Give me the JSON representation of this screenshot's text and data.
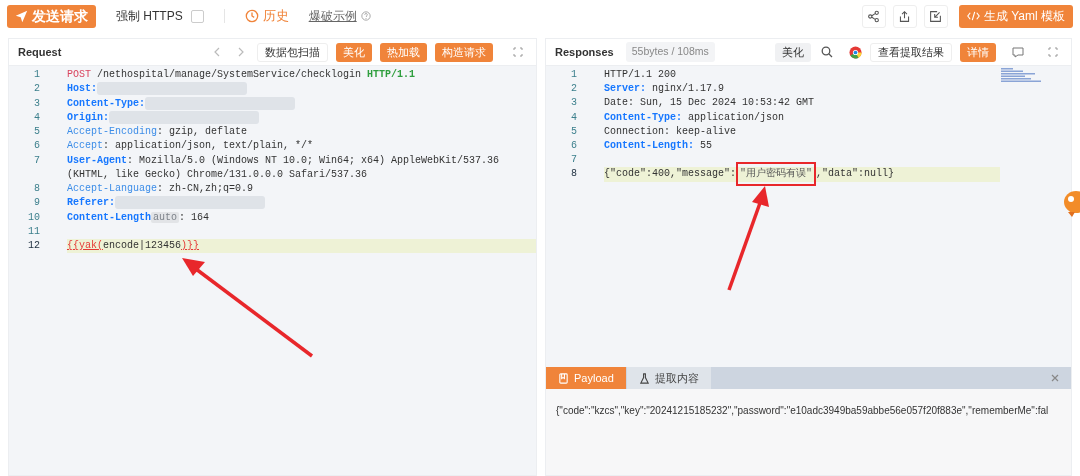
{
  "toolbar": {
    "send_button": "发送请求",
    "force_https": {
      "label": "强制 HTTPS",
      "checked": false
    },
    "history": "历史",
    "example_link": "爆破示例",
    "yaml_button": "生成 Yaml 模板"
  },
  "request": {
    "title": "Request",
    "buttons": [
      {
        "label": "数据包扫描",
        "kind": "default"
      },
      {
        "label": "美化",
        "kind": "primary"
      },
      {
        "label": "热加载",
        "kind": "primary"
      },
      {
        "label": "构造请求",
        "kind": "primary"
      }
    ],
    "lines": [
      {
        "number": "1",
        "highlighted": false,
        "segments": [
          {
            "kind": "method",
            "text": "POST"
          },
          {
            "kind": "plain",
            "text": " /nethospital/manage/SystemService/checklogin "
          },
          {
            "kind": "version",
            "text": "HTTP/1.1"
          }
        ]
      },
      {
        "number": "2",
        "highlighted": false,
        "segments": [
          {
            "kind": "key",
            "text": "Host:"
          },
          {
            "kind": "redacted"
          }
        ]
      },
      {
        "number": "3",
        "highlighted": false,
        "segments": [
          {
            "kind": "key",
            "text": "Content-Type:"
          },
          {
            "kind": "redacted"
          }
        ]
      },
      {
        "number": "4",
        "highlighted": false,
        "segments": [
          {
            "kind": "key",
            "text": "Origin:"
          },
          {
            "kind": "redacted"
          }
        ]
      },
      {
        "number": "5",
        "highlighted": false,
        "segments": [
          {
            "kind": "key_light",
            "text": "Accept-Encoding"
          },
          {
            "kind": "plain",
            "text": ": gzip, deflate"
          }
        ]
      },
      {
        "number": "6",
        "highlighted": false,
        "segments": [
          {
            "kind": "key_light",
            "text": "Accept"
          },
          {
            "kind": "plain",
            "text": ": application/json, text/plain, */*"
          }
        ]
      },
      {
        "number": "7",
        "highlighted": false,
        "segments": [
          {
            "kind": "key",
            "text": "User-Agent"
          },
          {
            "kind": "plain",
            "text": ": Mozilla/5.0 (Windows NT 10.0; Win64; x64) AppleWebKit/537.36 (KHTML, like Gecko) Chrome/131.0.0.0 Safari/537.36"
          }
        ]
      },
      {
        "number": "8",
        "highlighted": false,
        "segments": [
          {
            "kind": "key_light",
            "text": "Accept-Language"
          },
          {
            "kind": "plain",
            "text": ": zh-CN,zh;q=0.9"
          }
        ]
      },
      {
        "number": "9",
        "highlighted": false,
        "segments": [
          {
            "kind": "key",
            "text": "Referer:"
          },
          {
            "kind": "redacted"
          }
        ]
      },
      {
        "number": "10",
        "highlighted": false,
        "segments": [
          {
            "kind": "key",
            "text": "Content-Length"
          },
          {
            "kind": "badge",
            "text": "auto"
          },
          {
            "kind": "plain",
            "text": ": 164"
          }
        ]
      },
      {
        "number": "11",
        "highlighted": false
      },
      {
        "number": "12",
        "highlighted": true,
        "segments": [
          {
            "kind": "tag",
            "text": "{{yak("
          },
          {
            "kind": "plain",
            "text": "encode|123456"
          },
          {
            "kind": "tag",
            "text": ")}}"
          }
        ]
      }
    ]
  },
  "response": {
    "title": "Responses",
    "stats": "55bytes / 108ms",
    "buttons": [
      {
        "label": "美化",
        "kind": "muted"
      },
      {
        "label": "查看提取结果",
        "kind": "default"
      },
      {
        "label": "详情",
        "kind": "primary"
      }
    ],
    "lines": [
      {
        "number": "1",
        "highlighted": false,
        "segments": [
          {
            "kind": "plain",
            "text": "HTTP/1.1 200"
          }
        ]
      },
      {
        "number": "2",
        "highlighted": false,
        "segments": [
          {
            "kind": "key",
            "text": "Server:"
          },
          {
            "kind": "plain",
            "text": " nginx/1.17.9"
          }
        ]
      },
      {
        "number": "3",
        "highlighted": false,
        "segments": [
          {
            "kind": "plain",
            "text": "Date: Sun, 15 Dec 2024 10:53:42 GMT"
          }
        ]
      },
      {
        "number": "4",
        "highlighted": false,
        "segments": [
          {
            "kind": "key",
            "text": "Content-Type:"
          },
          {
            "kind": "plain",
            "text": " application/json"
          }
        ]
      },
      {
        "number": "5",
        "highlighted": false,
        "segments": [
          {
            "kind": "plain",
            "text": "Connection: keep-alive"
          }
        ]
      },
      {
        "number": "6",
        "highlighted": false,
        "segments": [
          {
            "kind": "key",
            "text": "Content-Length:"
          },
          {
            "kind": "plain",
            "text": " 55"
          }
        ]
      },
      {
        "number": "7",
        "highlighted": false
      },
      {
        "number": "8",
        "highlighted": true,
        "segments": [
          {
            "kind": "plain",
            "text": "{\"code\":400,\"message\":"
          },
          {
            "kind": "boxed",
            "text": "\"用户密码有误\""
          },
          {
            "kind": "plain",
            "text": ",\"data\":null}"
          }
        ]
      }
    ],
    "tabs": [
      {
        "label": "Payload",
        "selected": true
      },
      {
        "label": "提取内容",
        "selected": false
      }
    ],
    "payload": "{\"code\":\"kzcs\",\"key\":\"20241215185232\",\"password\":\"e10adc3949ba59abbe56e057f20f883e\",\"rememberMe\":fal"
  }
}
